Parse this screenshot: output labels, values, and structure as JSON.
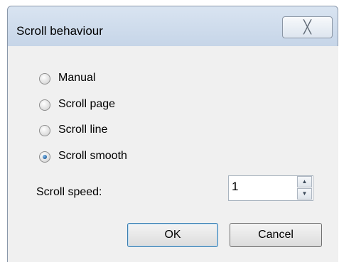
{
  "window": {
    "title": "Scroll behaviour",
    "close_glyph": "╳"
  },
  "options": [
    {
      "label": "Manual",
      "selected": false
    },
    {
      "label": "Scroll page",
      "selected": false
    },
    {
      "label": "Scroll line",
      "selected": false
    },
    {
      "label": "Scroll smooth",
      "selected": true
    }
  ],
  "scroll_speed": {
    "label": "Scroll speed:",
    "value": "1",
    "up_glyph": "▲",
    "down_glyph": "▼"
  },
  "buttons": {
    "ok_label": "OK",
    "cancel_label": "Cancel"
  }
}
